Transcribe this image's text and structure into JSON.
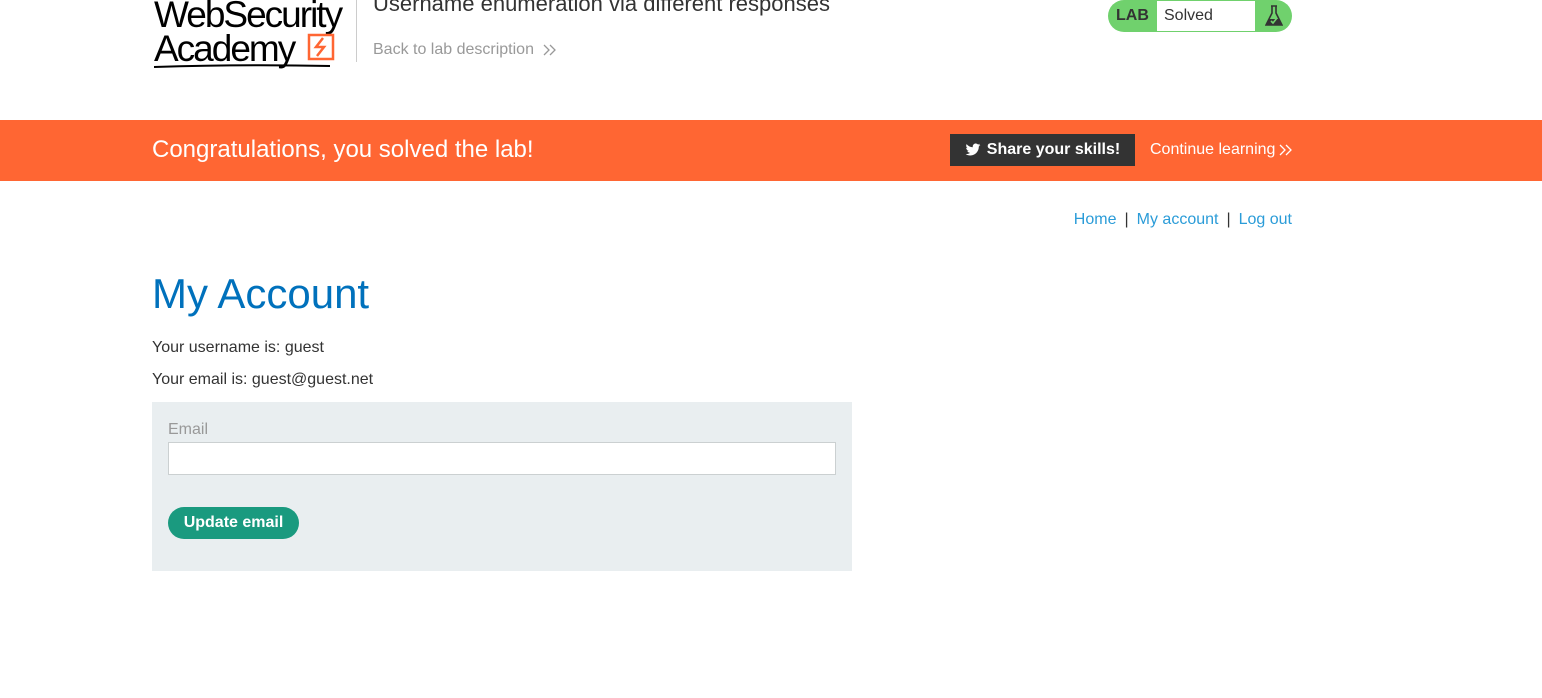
{
  "header": {
    "logo_line1": "WebSecurity",
    "logo_line2": "Academy",
    "lab_title": "Username enumeration via different responses",
    "back_link": "Back to lab description",
    "lab_status": {
      "label": "LAB",
      "state": "Solved",
      "icon": "flask-icon",
      "color": "#70d16d"
    }
  },
  "banner": {
    "message": "Congratulations, you solved the lab!",
    "share_label": "Share your skills!",
    "share_icon": "twitter-icon",
    "continue_label": "Continue learning",
    "color": "#ff6633"
  },
  "nav": {
    "items": [
      {
        "label": "Home"
      },
      {
        "label": "My account"
      },
      {
        "label": "Log out"
      }
    ],
    "separator": "|"
  },
  "main": {
    "title": "My Account",
    "username_line": "Your username is: guest",
    "email_line": "Your email is: guest@guest.net",
    "form": {
      "email_label": "Email",
      "email_value": "",
      "button_label": "Update email",
      "button_color": "#1a9a7f"
    }
  }
}
